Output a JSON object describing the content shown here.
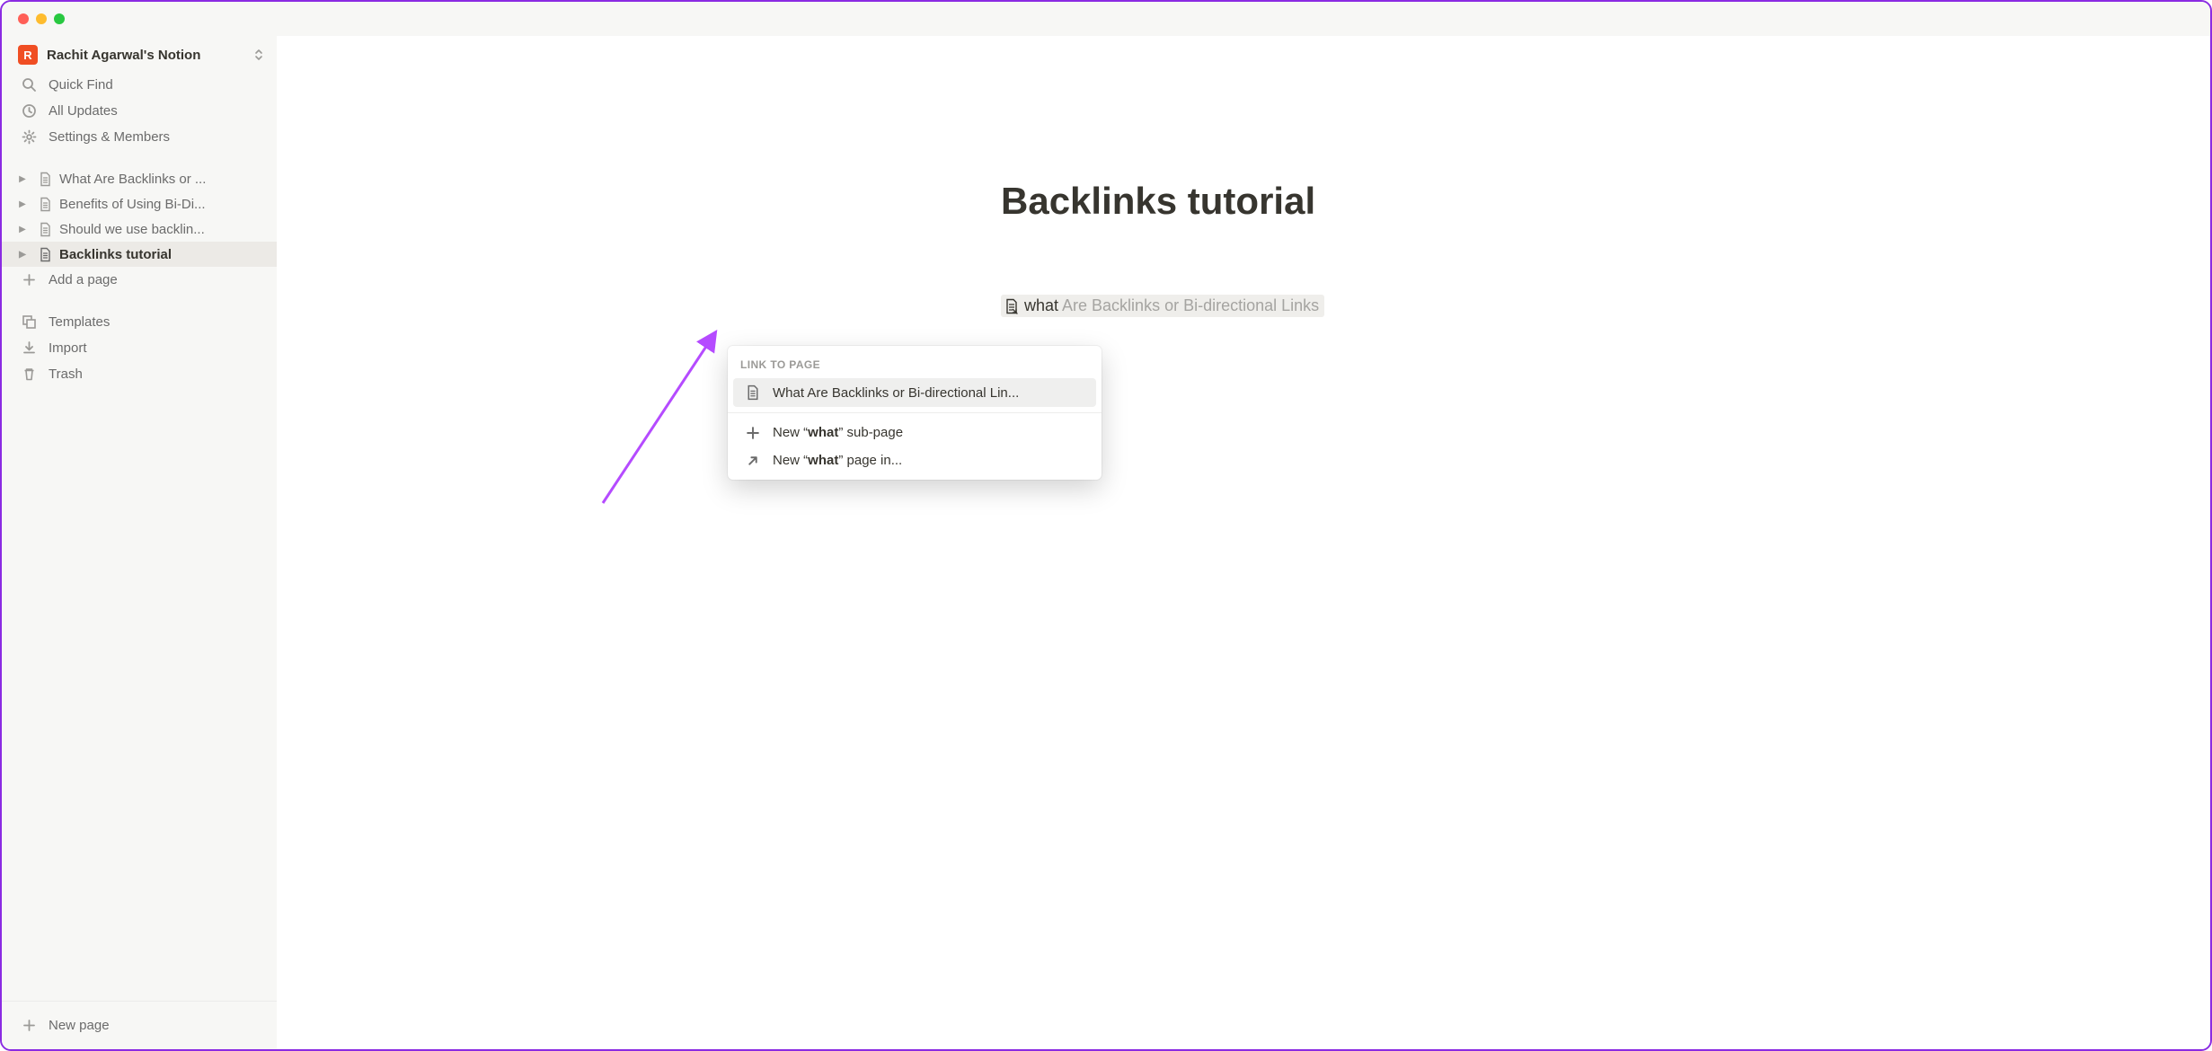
{
  "workspace": {
    "avatar_letter": "R",
    "name": "Rachit Agarwal's Notion"
  },
  "nav": {
    "quick_find": "Quick Find",
    "all_updates": "All Updates",
    "settings": "Settings & Members"
  },
  "pages": [
    {
      "label": "What Are Backlinks or ...",
      "active": false
    },
    {
      "label": "Benefits of Using Bi-Di...",
      "active": false
    },
    {
      "label": "Should we use backlin...",
      "active": false
    },
    {
      "label": "Backlinks tutorial",
      "active": true
    }
  ],
  "sidebar_actions": {
    "add_page": "Add a page",
    "templates": "Templates",
    "import": "Import",
    "trash": "Trash",
    "new_page": "New page"
  },
  "page": {
    "title": "Backlinks tutorial",
    "link_typed": "what",
    "link_completion": " Are Backlinks or Bi-directional Links"
  },
  "popup": {
    "header": "LINK TO PAGE",
    "result": "What Are Backlinks or Bi-directional Lin...",
    "new_subpage_prefix": "New “",
    "new_subpage_term": "what",
    "new_subpage_suffix": "” sub-page",
    "new_pagein_prefix": "New “",
    "new_pagein_term": "what",
    "new_pagein_suffix": "” page in..."
  }
}
